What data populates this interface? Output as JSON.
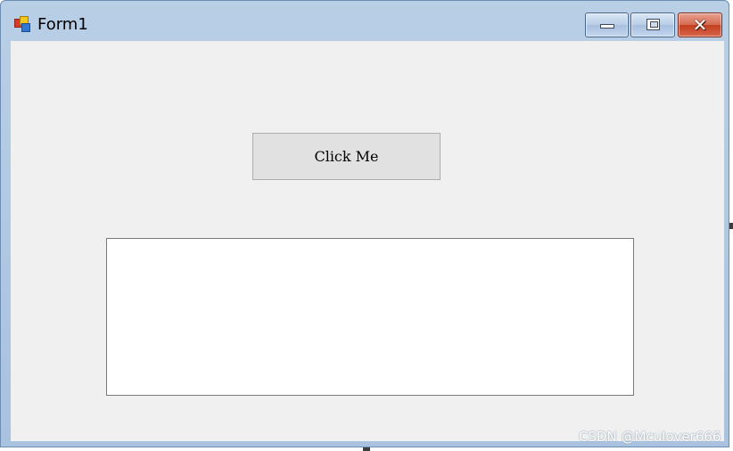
{
  "window": {
    "title": "Form1",
    "icon": "winforms-app-icon"
  },
  "titlebar_buttons": {
    "minimize_icon": "minimize-icon",
    "maximize_icon": "maximize-icon",
    "close_icon": "close-icon",
    "close_glyph": "✕"
  },
  "form": {
    "button_label": "Click Me",
    "textbox_value": ""
  },
  "watermark": "CSDN @Mculover666",
  "colors": {
    "client_background": "#f0f0f0",
    "button_face": "#e1e1e1",
    "close_button": "#c2401f",
    "titlebar": "#b9cfe6"
  }
}
